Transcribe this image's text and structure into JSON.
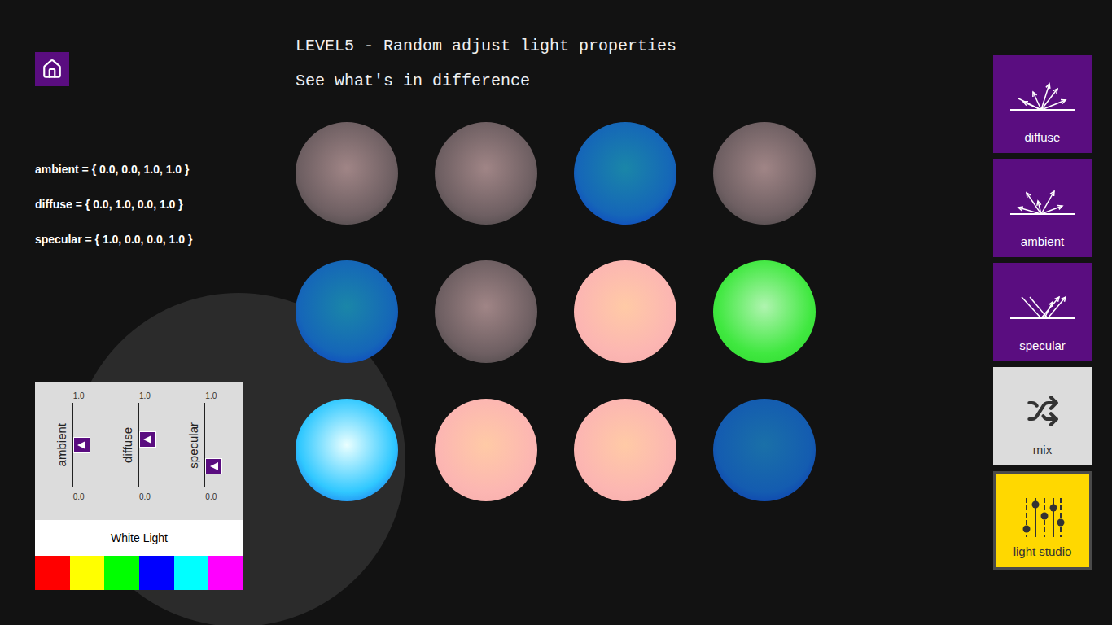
{
  "header": {
    "title": "LEVEL5 - Random adjust light properties",
    "subtitle": "See what's in difference"
  },
  "properties": [
    "ambient = { 0.0, 0.0, 1.0, 1.0 }",
    "diffuse = { 0.0, 1.0, 0.0, 1.0 }",
    "specular = { 1.0, 0.0, 0.0, 1.0 }"
  ],
  "spheres": [
    {
      "color": "#6e5f62",
      "highlight": "#a08586",
      "rim": "#3a3a3a"
    },
    {
      "color": "#6e5f62",
      "highlight": "#a08586",
      "rim": "#3a3a3a"
    },
    {
      "color": "#1566b8",
      "highlight": "#1a86a8",
      "rim": "#0a30c8"
    },
    {
      "color": "#6e5f62",
      "highlight": "#a08586",
      "rim": "#3a3a3a"
    },
    {
      "color": "#1566b8",
      "highlight": "#1a86a8",
      "rim": "#0a30c8"
    },
    {
      "color": "#6e5f62",
      "highlight": "#a08586",
      "rim": "#3a3a3a"
    },
    {
      "color": "#fcb6b2",
      "highlight": "#ffcaa6",
      "rim": "#f4aaaa"
    },
    {
      "color": "#40e840",
      "highlight": "#b0f4b0",
      "rim": "#28d428"
    },
    {
      "color": "#30c8ff",
      "highlight": "#eaffff",
      "rim": "#1048e0"
    },
    {
      "color": "#fcb6b2",
      "highlight": "#ffcaa6",
      "rim": "#f4aaaa"
    },
    {
      "color": "#fcb6b2",
      "highlight": "#ffcaa6",
      "rim": "#f4aaaa"
    },
    {
      "color": "#145cb0",
      "highlight": "#1a70a8",
      "rim": "#0a2cb0"
    }
  ],
  "studio": {
    "sliders": [
      {
        "label": "ambient",
        "max": "1.0",
        "min": "0.0",
        "level": 0.5
      },
      {
        "label": "diffuse",
        "max": "1.0",
        "min": "0.0",
        "level": 0.57
      },
      {
        "label": "specular",
        "max": "1.0",
        "min": "0.0",
        "level": 0.25
      }
    ],
    "light": "White Light",
    "swatches": [
      {
        "color": "#ff0000"
      },
      {
        "color": "#ffff00"
      },
      {
        "color": "#00ff00"
      },
      {
        "color": "#0000ff"
      },
      {
        "color": "#00ffff"
      },
      {
        "color": "#ff00ff"
      }
    ]
  },
  "tiles": [
    {
      "label": "diffuse",
      "kind": "diffuse",
      "selected": false
    },
    {
      "label": "ambient",
      "kind": "ambient",
      "selected": false
    },
    {
      "label": "specular",
      "kind": "specular",
      "selected": false
    },
    {
      "label": "mix",
      "kind": "mix",
      "selected": false
    },
    {
      "label": "light studio",
      "kind": "studio",
      "selected": true
    }
  ]
}
